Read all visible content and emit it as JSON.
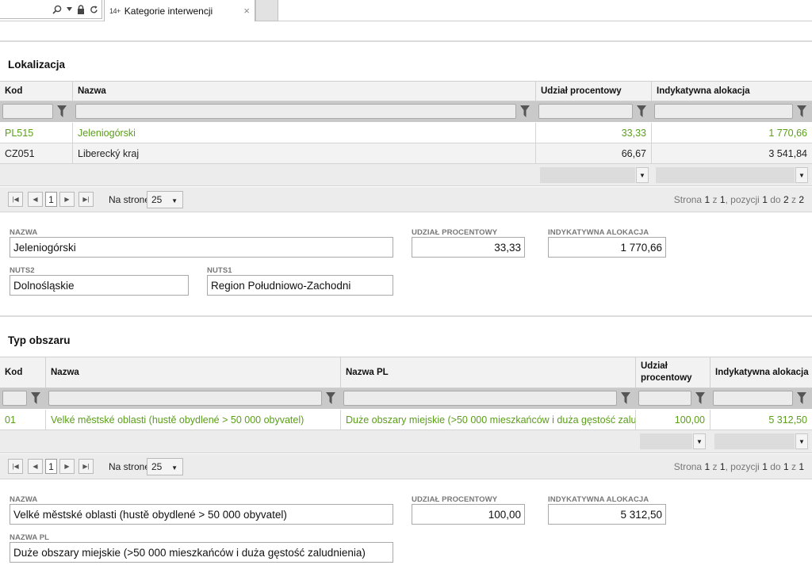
{
  "browser": {
    "tab_title": "Kategorie interwencji",
    "tab_icon": "14+",
    "close_glyph": "×"
  },
  "lokalizacja": {
    "title": "Lokalizacja",
    "columns": [
      "Kod",
      "Nazwa",
      "Udział procentowy",
      "Indykatywna alokacja"
    ],
    "rows": [
      {
        "kod": "PL515",
        "nazwa": "Jeleniogórski",
        "udzial": "33,33",
        "alokacja": "1 770,66"
      },
      {
        "kod": "CZ051",
        "nazwa": "Liberecký kraj",
        "udzial": "66,67",
        "alokacja": "3 541,84"
      }
    ],
    "pager": {
      "page": "1",
      "per_page_label": "Na stronę",
      "per_page": "25",
      "info": {
        "strona": "Strona",
        "page": "1",
        "z": "z",
        "total_pages": "1",
        "pozycji": ", pozycji",
        "from": "1",
        "do": "do",
        "to": "2",
        "z2": "z",
        "total": "2"
      }
    },
    "detail": {
      "nazwa_label": "NAZWA",
      "nazwa": "Jeleniogórski",
      "udzial_label": "UDZIAŁ PROCENTOWY",
      "udzial": "33,33",
      "alokacja_label": "INDYKATYWNA ALOKACJA",
      "alokacja": "1 770,66",
      "nuts2_label": "NUTS2",
      "nuts2": "Dolnośląskie",
      "nuts1_label": "NUTS1",
      "nuts1": "Region Południowo-Zachodni"
    }
  },
  "typ_obszaru": {
    "title": "Typ obszaru",
    "columns": [
      "Kod",
      "Nazwa",
      "Nazwa PL",
      "Udział procentowy",
      "Indykatywna alokacja"
    ],
    "rows": [
      {
        "kod": "01",
        "nazwa": "Velké městské oblasti (hustě obydlené > 50 000 obyvatel)",
        "nazwa_pl": "Duże obszary miejskie (>50 000 mieszkańców i duża gęstość zalud...",
        "udzial": "100,00",
        "alokacja": "5 312,50"
      }
    ],
    "pager": {
      "page": "1",
      "per_page_label": "Na stronę",
      "per_page": "25",
      "info": {
        "strona": "Strona",
        "page": "1",
        "z": "z",
        "total_pages": "1",
        "pozycji": ", pozycji",
        "from": "1",
        "do": "do",
        "to": "1",
        "z2": "z",
        "total": "1"
      }
    },
    "detail": {
      "nazwa_label": "NAZWA",
      "nazwa": "Velké městské oblasti (hustě obydlené > 50 000 obyvatel)",
      "udzial_label": "UDZIAŁ PROCENTOWY",
      "udzial": "100,00",
      "alokacja_label": "INDYKATYWNA ALOKACJA",
      "alokacja": "5 312,50",
      "nazwa_pl_label": "NAZWA PL",
      "nazwa_pl": "Duże obszary miejskie (>50 000 mieszkańców i duża gęstość zaludnienia)"
    }
  },
  "colors": {
    "selected_row": "#5a9e19",
    "filter_bar": "#c9c9c9"
  },
  "icons": [
    "search-icon",
    "dropdown-arrow-icon",
    "lock-icon",
    "refresh-icon",
    "close-icon",
    "filter-icon",
    "first-page-icon",
    "prev-page-icon",
    "next-page-icon",
    "last-page-icon"
  ]
}
